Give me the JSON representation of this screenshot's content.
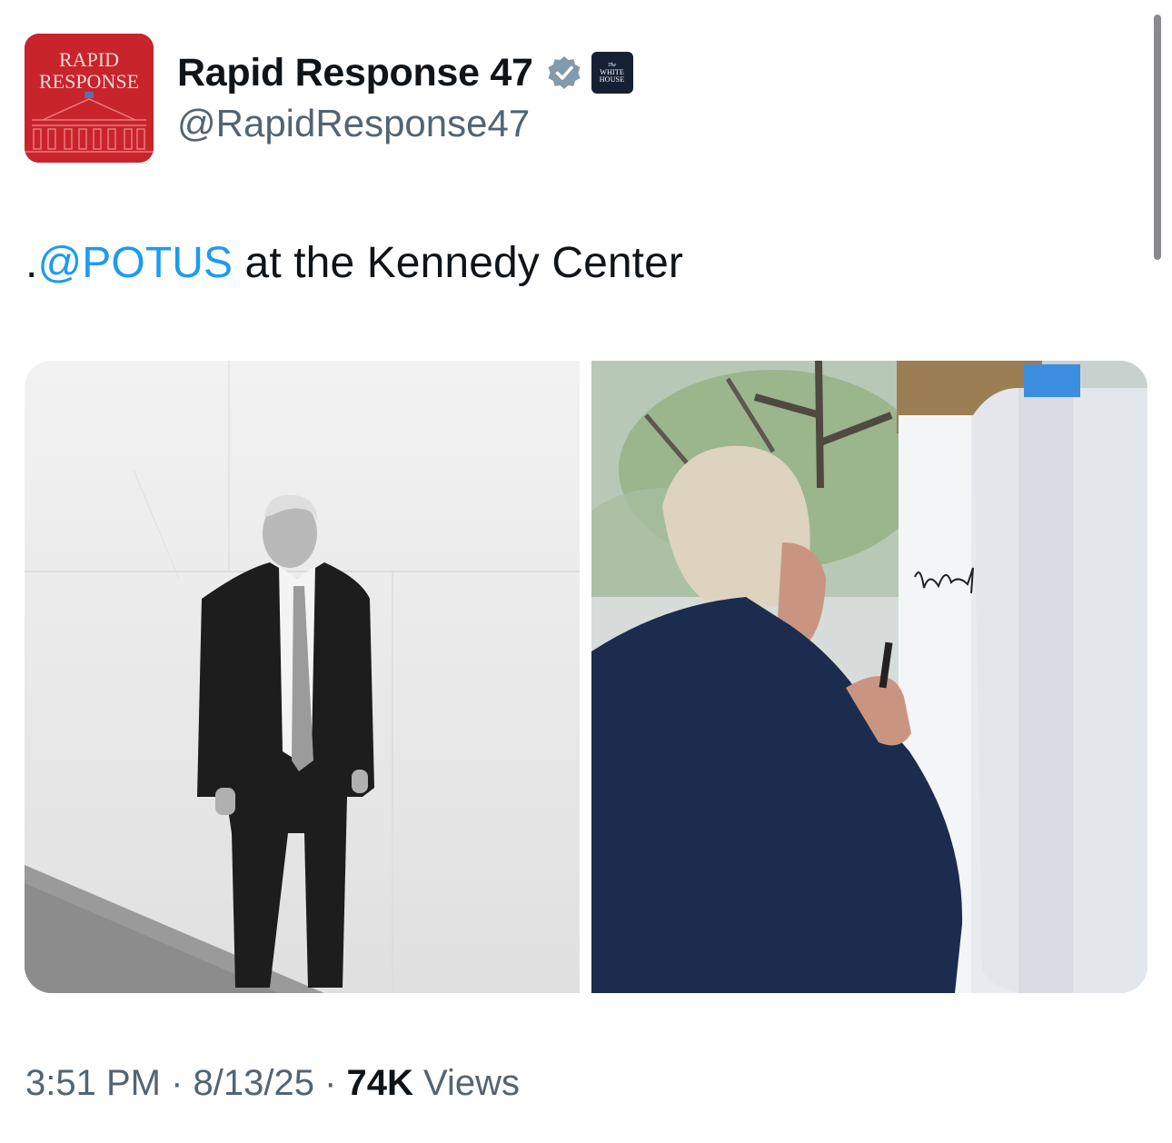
{
  "author": {
    "display_name": "Rapid Response 47",
    "handle": "@RapidResponse47",
    "avatar_text_top": "RAPID",
    "avatar_text_bottom": "RESPONSE",
    "avatar_color": "#c8242c",
    "verified_icon": "verified-badge-icon",
    "verified_color": "#829aab",
    "affiliation_the": "The",
    "affiliation_name": "WHITE HOUSE",
    "affiliation_color": "#162034"
  },
  "tweet": {
    "text_prefix": ".",
    "mention": "@POTUS",
    "text_rest": " at the Kennedy Center",
    "mention_color": "#1d9bf0"
  },
  "media": {
    "images": [
      {
        "description_icon": "photo-bw-portrait"
      },
      {
        "description_icon": "photo-signing-beam"
      }
    ]
  },
  "meta": {
    "time": "3:51 PM",
    "sep1": " · ",
    "date": "8/13/25",
    "sep2": " · ",
    "views_count": "74K",
    "views_label": " Views"
  }
}
